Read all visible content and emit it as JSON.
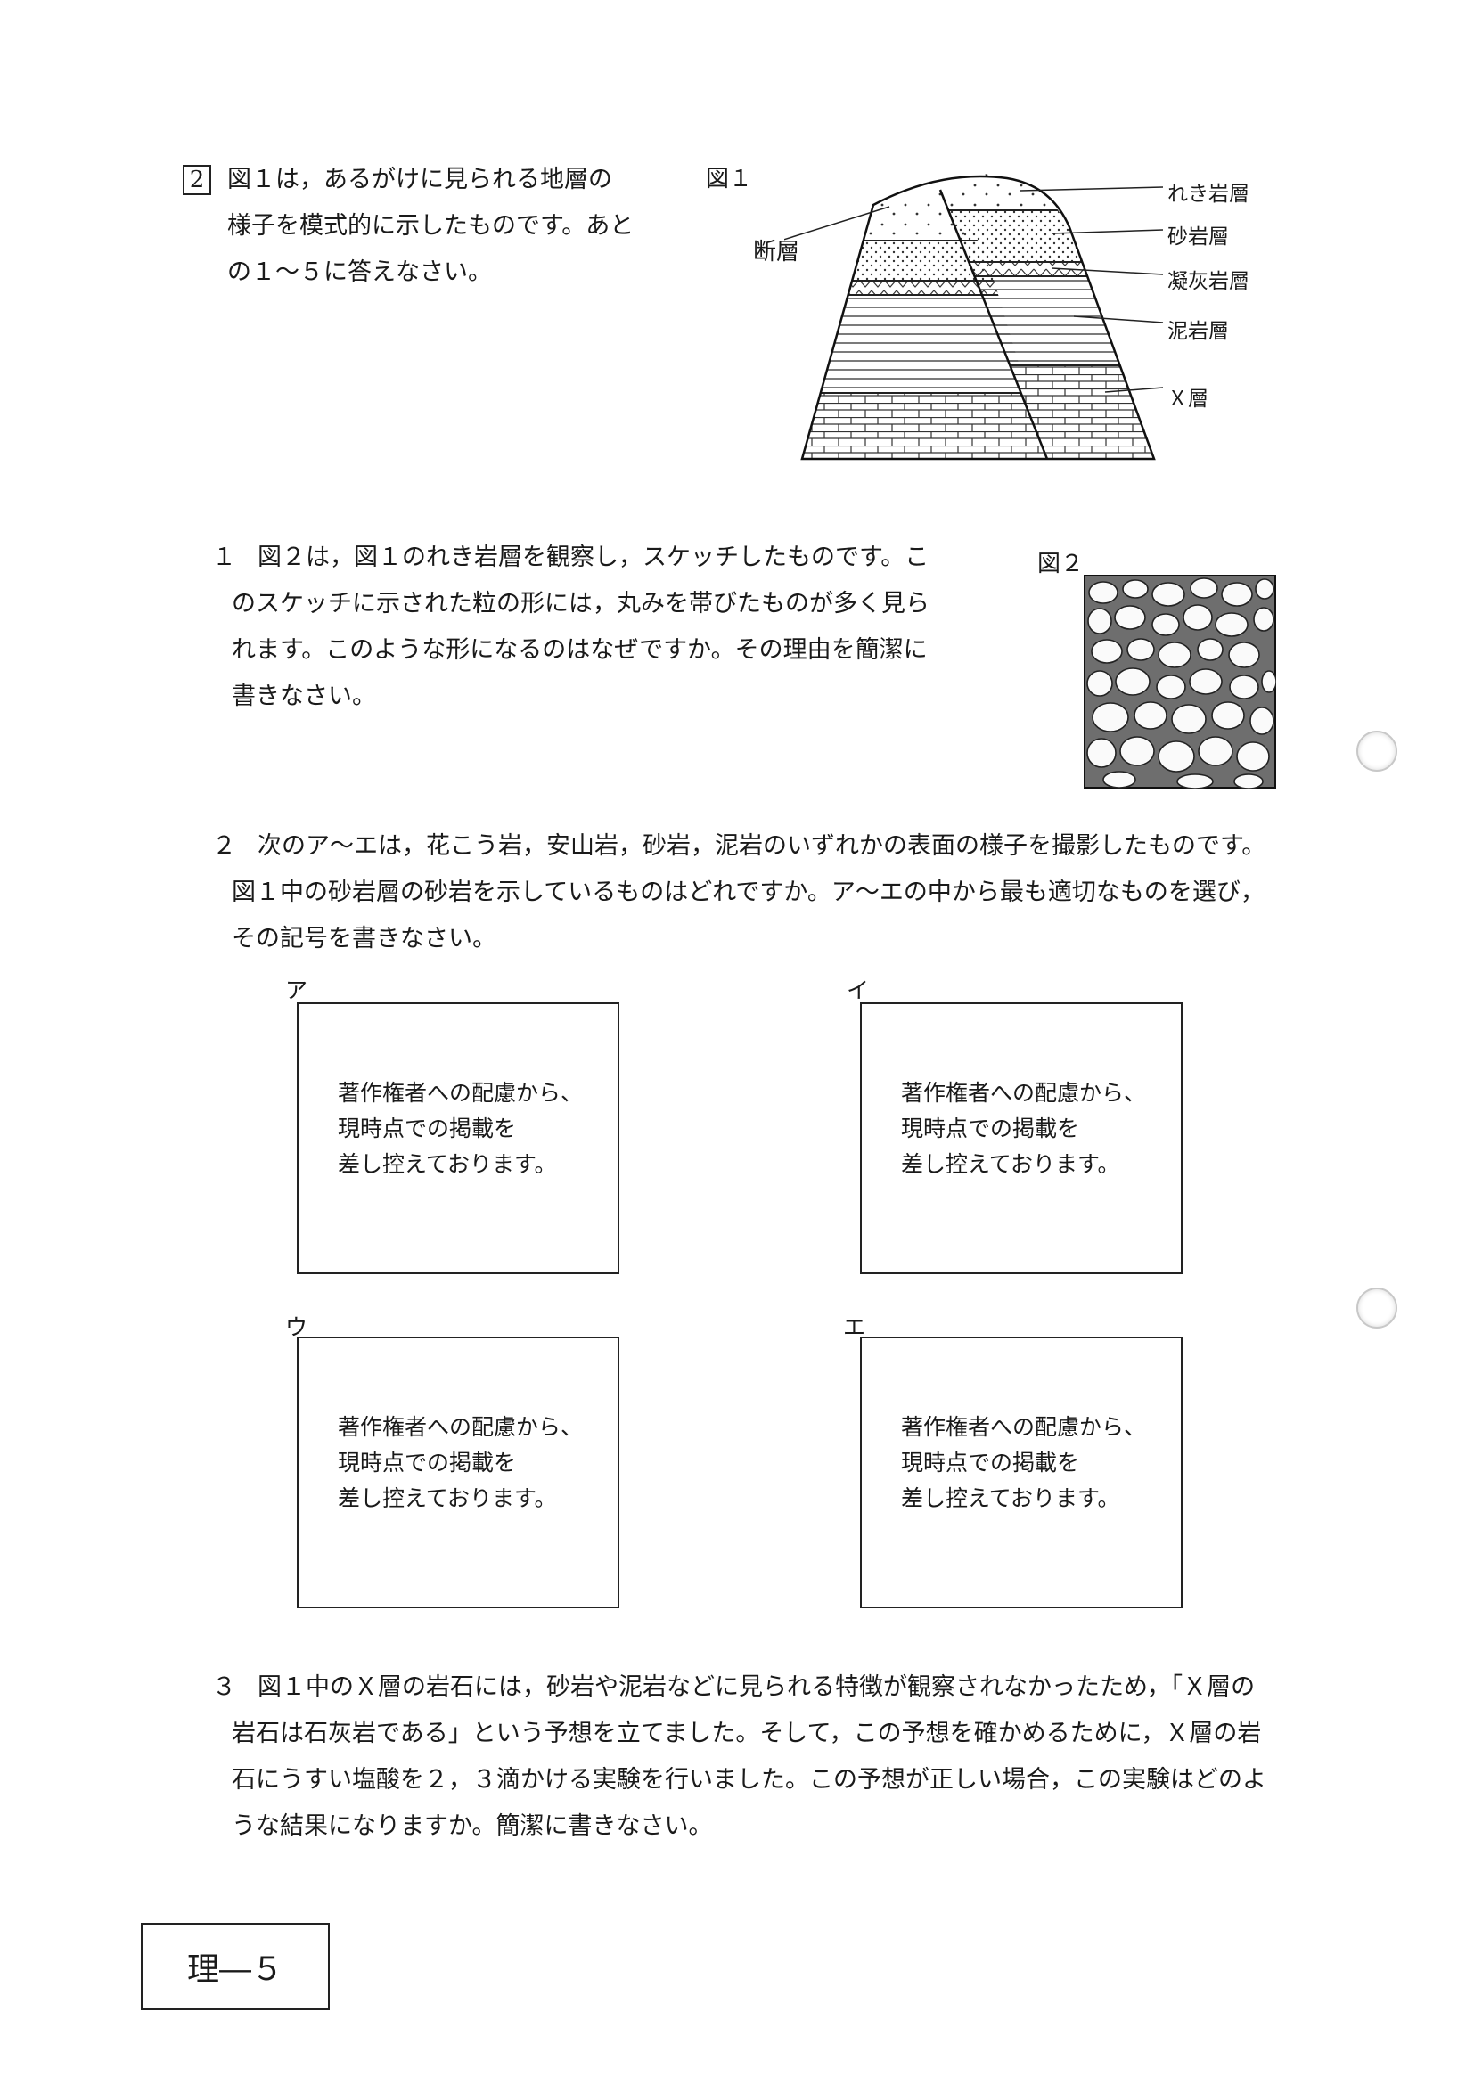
{
  "section": {
    "number": "2",
    "intro_lines": [
      "図１は，あるがけに見られる地層の",
      "様子を模式的に示したものです。あと",
      "の１～５に答えなさい。"
    ]
  },
  "figure1": {
    "label": "図１",
    "fault_label": "断層",
    "layer_labels": [
      "れき岩層",
      "砂岩層",
      "凝灰岩層",
      "泥岩層",
      "Ｘ層"
    ]
  },
  "q1": {
    "number": "１",
    "lines": [
      "図２は，図１のれき岩層を観察し，スケッチしたものです。こ",
      "のスケッチに示された粒の形には，丸みを帯びたものが多く見ら",
      "れます。このような形になるのはなぜですか。その理由を簡潔に",
      "書きなさい。"
    ]
  },
  "figure2": {
    "label": "図２"
  },
  "q2": {
    "number": "２",
    "lines": [
      "次のア～エは，花こう岩，安山岩，砂岩，泥岩のいずれかの表面の様子を撮影したものです。",
      "図１中の砂岩層の砂岩を示しているものはどれですか。ア～エの中から最も適切なものを選び，",
      "その記号を書きなさい。"
    ],
    "choices": [
      {
        "label": "ア",
        "notice": [
          "著作権者への配慮から、",
          "現時点での掲載を",
          "差し控えております。"
        ]
      },
      {
        "label": "イ",
        "notice": [
          "著作権者への配慮から、",
          "現時点での掲載を",
          "差し控えております。"
        ]
      },
      {
        "label": "ウ",
        "notice": [
          "著作権者への配慮から、",
          "現時点での掲載を",
          "差し控えております。"
        ]
      },
      {
        "label": "エ",
        "notice": [
          "著作権者への配慮から、",
          "現時点での掲載を",
          "差し控えております。"
        ]
      }
    ]
  },
  "q3": {
    "number": "３",
    "lines": [
      "図１中のＸ層の岩石には，砂岩や泥岩などに見られる特徴が観察されなかったため，「Ｘ層の",
      "岩石は石灰岩である」という予想を立てました。そして，この予想を確かめるために，Ｘ層の岩",
      "石にうすい塩酸を２，３滴かける実験を行いました。この予想が正しい場合，この実験はどのよ",
      "うな結果になりますか。簡潔に書きなさい。"
    ]
  },
  "page_label": "理―５"
}
